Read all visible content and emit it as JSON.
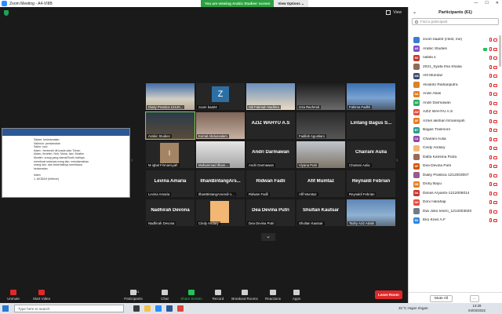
{
  "window": {
    "title": "Zoom Meeting - A4-VIIIB"
  },
  "banner": {
    "viewing": "You are viewing Arabic Studies' screen",
    "view_options": "View Options ⌄"
  },
  "view_label": "View",
  "share_doc": {
    "lines": [
      "Salam: keselamatan",
      "Salimun: perdamaian",
      "Salim: suci",
      "Islam : berserah diri pada satu Tuhan",
      "Adam, Ibrahim, Nuh, Musa, Isa= Muslim",
      "Muslim: orang yang damai/Sucik hatinya,",
      "membuat selamat orang lain, mendamaikan",
      "orang lain, dan bekehatinya membawa",
      "kedamaian.",
      "",
      "Islam",
      "1. AKIDAH (believe)"
    ]
  },
  "tiles": [
    {
      "label": "Diaity Prastica 12120...",
      "big": ""
    },
    {
      "label": "zoom baa04",
      "big": "",
      "letter": "Z"
    },
    {
      "label": "Siti Fatimah Nadhira",
      "big": ""
    },
    {
      "label": "Izza Rachmid",
      "big": ""
    },
    {
      "label": "Fahima Fadhli",
      "big": ""
    },
    {
      "label": "Arabic Studies",
      "big": ""
    },
    {
      "label": "Kemal Abdussalam",
      "big": ""
    },
    {
      "label": "",
      "big": "AZIZ WAHYU A.S"
    },
    {
      "label": "Fadilah Agustiani",
      "big": ""
    },
    {
      "label": "",
      "big": "Lintang Bagus S..."
    },
    {
      "label": "M iqbal Firmansyah",
      "big": "",
      "letter": "I"
    },
    {
      "label": "Muhammad Ilham...",
      "big": ""
    },
    {
      "label": "Andri Darmawan",
      "big": "Andri Darmawan"
    },
    {
      "label": "Viyana Putri",
      "big": ""
    },
    {
      "label": "Chairani Aulia",
      "big": "Chairani Aulia"
    },
    {
      "label": "Levina Amaria",
      "big": "Levina Amaria"
    },
    {
      "label": "IlhanBintangArsendi-1...",
      "big": "IlhanBintangArs..."
    },
    {
      "label": "Ridwan Fadli",
      "big": "Ridwan Fadli"
    },
    {
      "label": "Afif Mumtaz",
      "big": "Afif Mumtaz"
    },
    {
      "label": "Reynaldi Febrian",
      "big": "Reynaldi Febrian"
    },
    {
      "label": "Nadhirah Devona",
      "big": "Nadhirah Devona"
    },
    {
      "label": "Cindy Andary",
      "big": ""
    },
    {
      "label": "Dea Devina Putri",
      "big": "Dea Devina Putri"
    },
    {
      "label": "Shultan Kautsar",
      "big": "Shultan Kautsar"
    },
    {
      "label": "Tazky Aziz Adabi",
      "big": ""
    }
  ],
  "toolbar": {
    "unmute": "Unmute",
    "start_video": "Start Video",
    "participants": "Participants",
    "participants_count": "61",
    "chat": "Chat",
    "share_screen": "Share Screen",
    "record": "Record",
    "breakout": "Breakout Rooms",
    "reactions": "Reactions",
    "apps": "Apps",
    "leave": "Leave Room"
  },
  "panel": {
    "title": "Participants (61)",
    "search_placeholder": "Find a participant",
    "participants": [
      {
        "initials": "",
        "name": "zoom baa04 (Host, me)",
        "color": "#3a7bd5"
      },
      {
        "initials": "AS",
        "name": "Arabic Studies",
        "color": "#7b4fc6"
      },
      {
        "initials": "NS",
        "name": "nabila s",
        "color": "#c0392b"
      },
      {
        "initials": "",
        "name": "2021_Syafa Ifna Shalia",
        "color": "#8e6b5b"
      },
      {
        "initials": "AM",
        "name": "Afif Mumtaz",
        "color": "#3a4a6b"
      },
      {
        "initials": "",
        "name": "Alvianto Raihanputra",
        "color": "#d9822b"
      },
      {
        "initials": "AA",
        "name": "Andri Abas",
        "color": "#e67e22"
      },
      {
        "initials": "AD",
        "name": "Andri Darmawan",
        "color": "#27ae60"
      },
      {
        "initials": "AW",
        "name": "AZIZ WAHYU A.S",
        "color": "#e74c3c"
      },
      {
        "initials": "AF",
        "name": "Azriel akshan firmansyah",
        "color": "#e67e22"
      },
      {
        "initials": "BT",
        "name": "Bagas Trasmoro",
        "color": "#2a9d8f"
      },
      {
        "initials": "CA",
        "name": "Chairani Aulia",
        "color": "#8e44ad"
      },
      {
        "initials": "",
        "name": "Cindy Andary",
        "color": "#f2b775"
      },
      {
        "initials": "",
        "name": "Daffa Karisma Putra",
        "color": "#9a6b5a"
      },
      {
        "initials": "DP",
        "name": "Dea Devina Putri",
        "color": "#d35400"
      },
      {
        "initials": "",
        "name": "Diaity Prastica 1212003007",
        "color": "#9a5b8a"
      },
      {
        "initials": "DB",
        "name": "Dicky Bayu",
        "color": "#e67e22"
      },
      {
        "initials": "DA",
        "name": "Dimas Aryanto-1212005014",
        "color": "#c0392b"
      },
      {
        "initials": "DH",
        "name": "Doni Harahap",
        "color": "#e74c3c"
      },
      {
        "initials": "",
        "name": "Dwi Joko Ieloro_1212003020",
        "color": "#6d7c8c"
      },
      {
        "initials": "EK",
        "name": "Eko Kries A.F",
        "color": "#2e86de"
      }
    ],
    "mute_all": "Mute All",
    "more": "..."
  },
  "taskbar": {
    "search": "Type here to search",
    "weather": "31°C  Hujan ringan",
    "time": "13:29",
    "date": "04/03/2022"
  }
}
